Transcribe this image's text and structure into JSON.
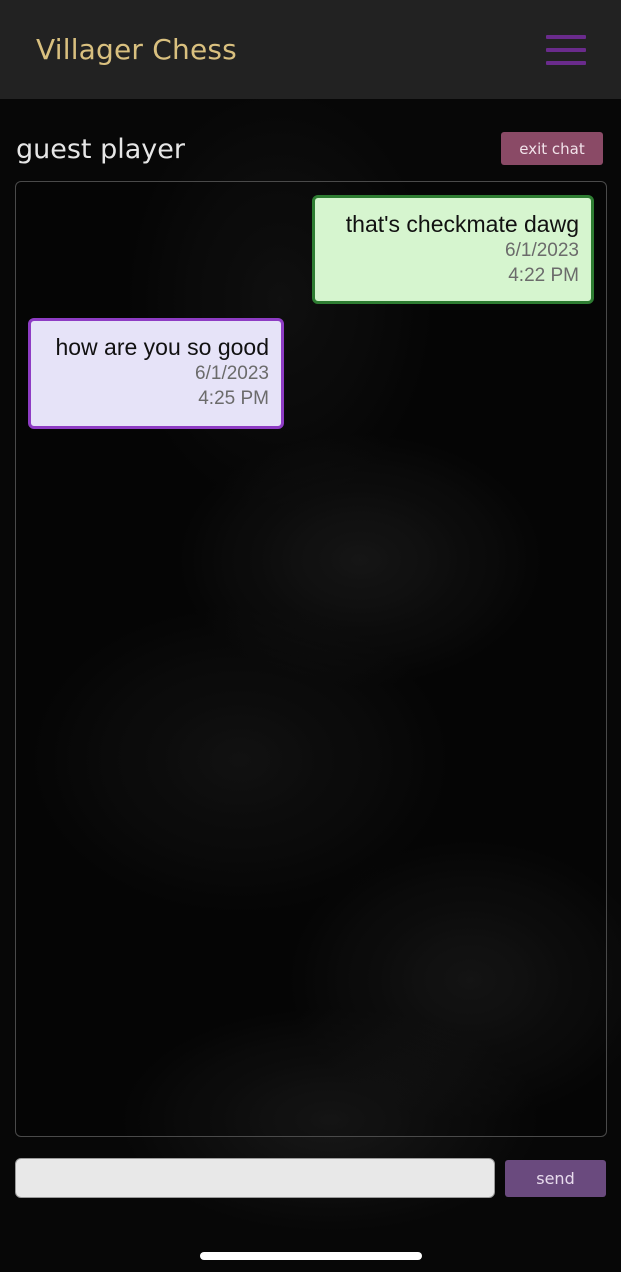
{
  "app": {
    "brand": "Villager Chess",
    "brand_color": "#d9c07f",
    "menu_icon": "hamburger-menu-icon",
    "menu_color": "#6a2b8c"
  },
  "chat": {
    "title": "guest player",
    "exit_label": "exit chat",
    "exit_color": "#8a4a66",
    "messages": [
      {
        "side": "sent",
        "text": "that's checkmate dawg",
        "date": "6/1/2023",
        "time": "4:22 PM",
        "background": "#d6f5cf",
        "border": "#2e7d32"
      },
      {
        "side": "received",
        "text": "how are you so good",
        "date": "6/1/2023",
        "time": "4:25 PM",
        "background": "#e6e3f8",
        "border": "#8e3cc4"
      }
    ]
  },
  "composer": {
    "input_value": "",
    "input_placeholder": "",
    "send_label": "send",
    "send_color": "#6a4a7e"
  }
}
